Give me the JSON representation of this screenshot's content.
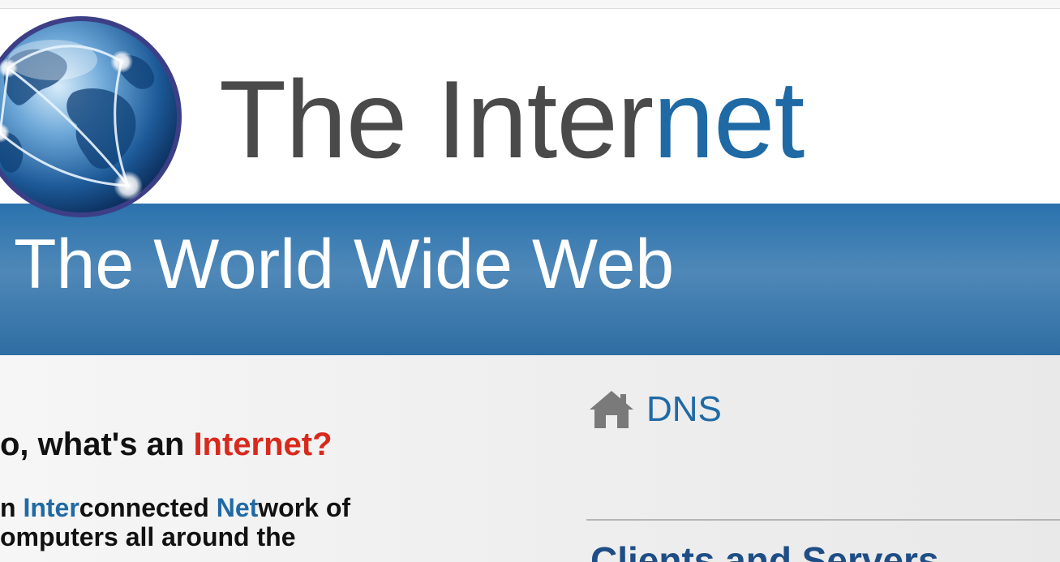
{
  "header": {
    "title_main": "The Inter",
    "title_accent": "net"
  },
  "banner": {
    "title": "The World Wide Web"
  },
  "article": {
    "question_prefix": "o, what's an ",
    "question_highlight": "Internet?",
    "para_line1_a": "n ",
    "para_line1_b": "Inter",
    "para_line1_c": "connected ",
    "para_line1_d": "Net",
    "para_line1_e": "work of",
    "para_line2": "omputers all around the"
  },
  "sidebar": {
    "dns_label": "DNS",
    "clients_heading": "Clients and Servers"
  },
  "colors": {
    "accent_blue": "#1f6aa5",
    "highlight_red": "#d9291c",
    "banner_blue": "#2a72ad",
    "heading_navy": "#1f4e86"
  },
  "icons": {
    "logo": "globe-icon",
    "dns": "house-icon"
  }
}
